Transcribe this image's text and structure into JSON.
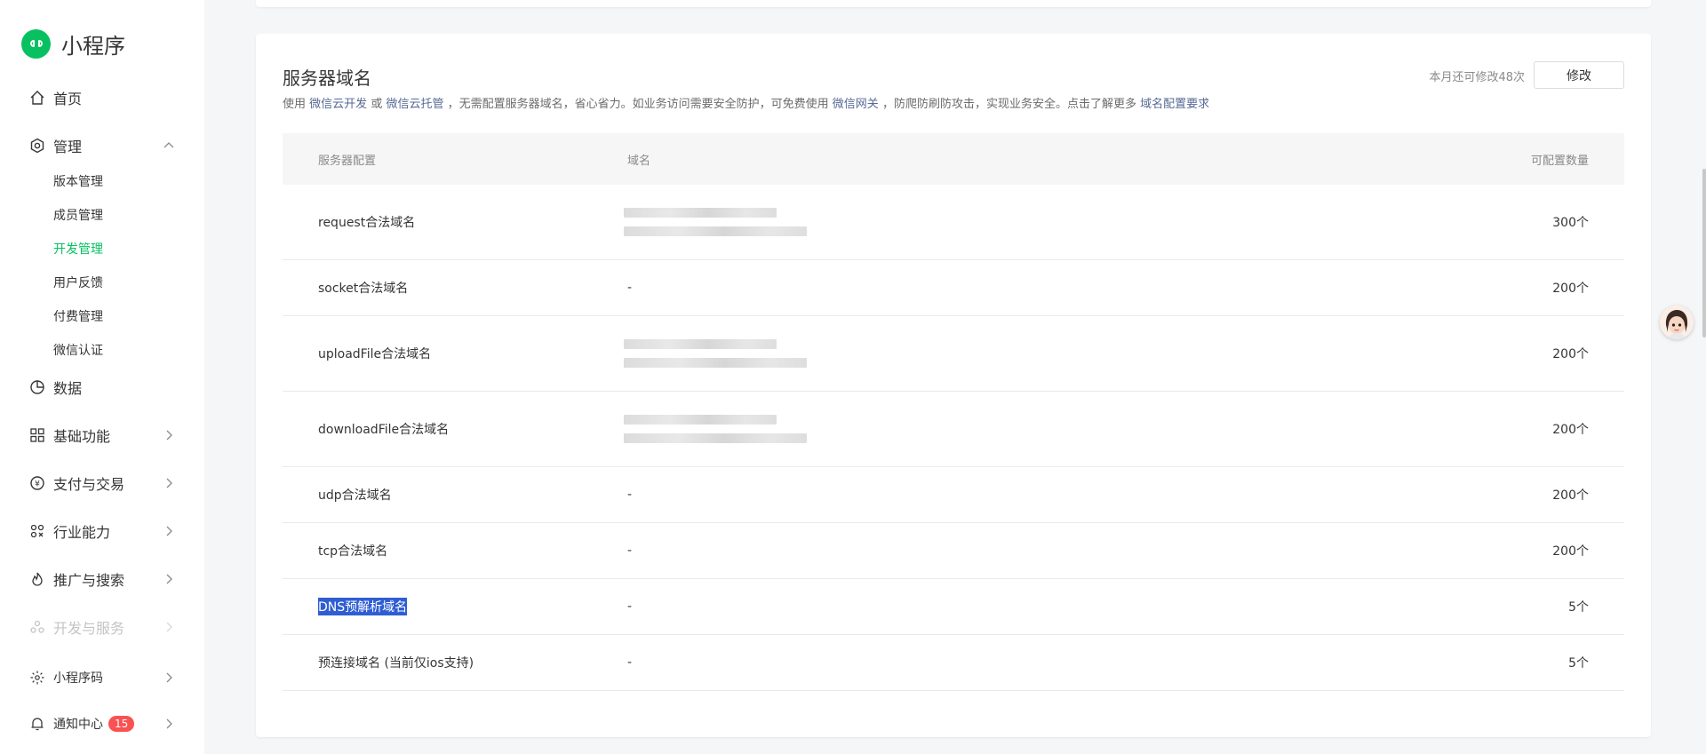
{
  "app": {
    "name": "小程序",
    "brand_color": "#07c160"
  },
  "sidebar": {
    "items": [
      {
        "label": "首页",
        "icon": "home-icon"
      },
      {
        "label": "管理",
        "icon": "gear-icon",
        "expanded": true,
        "children": [
          "版本管理",
          "成员管理",
          "开发管理",
          "用户反馈",
          "付费管理",
          "微信认证"
        ],
        "active_child": "开发管理"
      },
      {
        "label": "数据",
        "icon": "pie-chart-icon"
      },
      {
        "label": "基础功能",
        "icon": "grid-icon"
      },
      {
        "label": "支付与交易",
        "icon": "yuan-icon"
      },
      {
        "label": "行业能力",
        "icon": "nodes-icon"
      },
      {
        "label": "推广与搜索",
        "icon": "flame-icon"
      },
      {
        "label": "开发与服务",
        "icon": "people-icon",
        "disabled": true
      },
      {
        "label": "小程序码",
        "icon": "code-icon"
      },
      {
        "label": "通知中心",
        "icon": "bell-icon",
        "badge": "15"
      }
    ]
  },
  "server_domain": {
    "title": "服务器域名",
    "desc_prefix": "使用",
    "link_cloud_dev": "微信云开发",
    "or": "或",
    "link_cloud_host": "微信云托管",
    "desc_mid": "，无需配置服务器域名，省心省力。如业务访问需要安全防护，可免费使用",
    "link_gateway": "微信网关",
    "desc_mid2": "，防爬防刷防攻击，实现业务安全。点击了解更多",
    "link_requirements": "域名配置要求",
    "quota_text": "本月还可修改48次",
    "edit_label": "修改",
    "columns": [
      "服务器配置",
      "域名",
      "可配置数量"
    ],
    "rows": [
      {
        "name": "request合法域名",
        "domain": null,
        "count": "300个"
      },
      {
        "name": "socket合法域名",
        "domain": "-",
        "count": "200个"
      },
      {
        "name": "uploadFile合法域名",
        "domain": null,
        "count": "200个"
      },
      {
        "name": "downloadFile合法域名",
        "domain": null,
        "count": "200个"
      },
      {
        "name": "udp合法域名",
        "domain": "-",
        "count": "200个"
      },
      {
        "name": "tcp合法域名",
        "domain": "-",
        "count": "200个"
      },
      {
        "name": "DNS预解析域名",
        "domain": "-",
        "count": "5个",
        "selected": true
      },
      {
        "name": "预连接域名 (当前仅ios支持)",
        "domain": "-",
        "count": "5个"
      }
    ]
  },
  "colors": {
    "link": "#576b95",
    "selection": "#2f5ed3",
    "badge": "#fa5151"
  }
}
